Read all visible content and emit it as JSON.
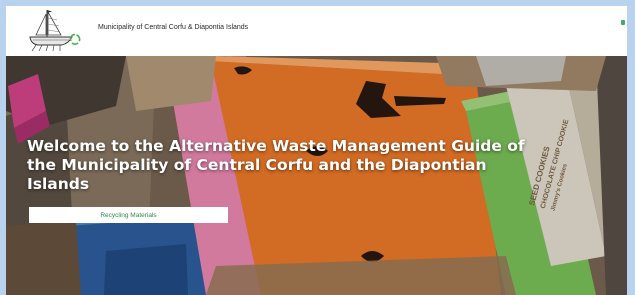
{
  "header": {
    "site_title": "Municipality of Central Corfu & Diapontia Islands",
    "logo_icon": "ship-recycle-logo-icon"
  },
  "hero": {
    "title": "Welcome to the Alternative Waste Management Guide of the Municipality of Central Corfu and the Diapontian Islands",
    "button_label": "Recycling Materials",
    "box_print_1": "SEED COOKIES",
    "box_print_2": "CHOCOLATE CHIP COOKIE",
    "box_print_3": "Jimmy's Cookies"
  },
  "colors": {
    "frame": "#b9d3ee",
    "button_text": "#2e8b4e",
    "orange_cardboard": "#f07a2a",
    "green_cardboard": "#7dc35a",
    "pink_cardboard": "#f08ab4",
    "blue_cardboard": "#3f78b8"
  }
}
